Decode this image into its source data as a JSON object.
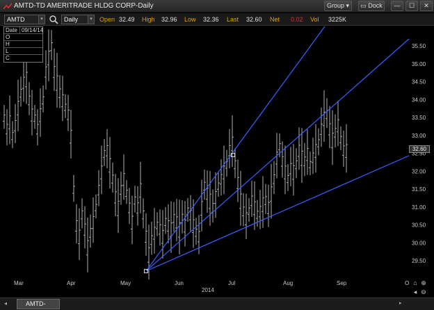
{
  "window": {
    "title": "AMTD-TD AMERITRADE HLDG CORP-Daily",
    "group_label": "Group",
    "dock_label": "Dock",
    "minimize_glyph": "—",
    "maximize_glyph": "☐",
    "close_glyph": "✕"
  },
  "toolbar": {
    "symbol": "AMTD",
    "period": "Daily",
    "quote": {
      "open_label": "Open",
      "open": "32.49",
      "high_label": "High",
      "high": "32.96",
      "low_label": "Low",
      "low": "32.36",
      "last_label": "Last",
      "last": "32.60",
      "net_label": "Net",
      "net": "0.02",
      "vol_label": "Vol",
      "vol": "3225K"
    },
    "net_color": "#e03030"
  },
  "ohlc_panel": {
    "date_label": "Date",
    "date": "09/14/14",
    "o_label": "O",
    "h_label": "H",
    "l_label": "L",
    "c_label": "C"
  },
  "chart_data": {
    "type": "ohlc-bar",
    "y_ticks": [
      "35.50",
      "35.00",
      "34.50",
      "34.00",
      "33.50",
      "33.00",
      "32.50",
      "32.00",
      "31.50",
      "31.00",
      "30.50",
      "30.00",
      "29.50"
    ],
    "ylim": [
      29.2,
      35.85
    ],
    "x_ticks": [
      "Mar",
      "Apr",
      "May",
      "Jun",
      "Jul",
      "Aug",
      "Sep",
      "O"
    ],
    "year_label": "2014",
    "last_price_tag": "32.60",
    "bar_color": "#b0b0b0",
    "trendline_color": "#3a5fff",
    "grid": false
  },
  "bottom": {
    "tab_label": "AMTD-Daily"
  },
  "icons": {
    "logo": "chart-logo-icon",
    "search": "search-icon",
    "home": "home-icon"
  }
}
